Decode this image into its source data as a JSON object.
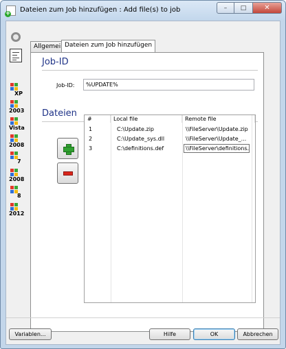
{
  "window": {
    "title": "Dateien zum Job hinzufügen : Add file(s) to job",
    "controls": [
      "minimize",
      "maximize",
      "close"
    ]
  },
  "left_toolbar": {
    "items": [
      {
        "icon": "settings-circle-icon"
      },
      {
        "icon": "document-icon"
      }
    ],
    "os_list": [
      {
        "label": "XP"
      },
      {
        "label": "2003"
      },
      {
        "label": "Vista"
      },
      {
        "label": "2008"
      },
      {
        "label": "7"
      },
      {
        "label": "2008"
      },
      {
        "label": "8"
      },
      {
        "label": "2012"
      }
    ],
    "os_flag_colors": [
      "#e2372a",
      "#3aa836",
      "#2f6fd8",
      "#f3bb12"
    ]
  },
  "tabs": [
    {
      "label": "Allgemein",
      "active": false
    },
    {
      "label": "Dateien zum Job hinzufügen",
      "active": true
    }
  ],
  "job_section": {
    "title": "Job-ID",
    "field_label": "Job-ID:",
    "field_value": "%UPDATE%"
  },
  "files_section": {
    "title": "Dateien",
    "columns": [
      "#",
      "Local file",
      "Remote file"
    ],
    "rows": [
      {
        "index": "1",
        "local": "C:\\Update.zip",
        "remote": "\\\\FileServer\\Update.zip"
      },
      {
        "index": "2",
        "local": "C:\\Update_sys.dll",
        "remote": "\\\\FileServer\\Update_..."
      },
      {
        "index": "3",
        "local": "C:\\definitions.def",
        "remote": "\\\\FileServer\\definitions."
      }
    ]
  },
  "buttons": {
    "variables": "Variablen...",
    "help": "Hilfe",
    "ok": "OK",
    "cancel": "Abbrechen"
  },
  "colors": {
    "section_title": "#1e3287",
    "add_icon": "#2fa02f",
    "remove_icon": "#d9261c"
  }
}
